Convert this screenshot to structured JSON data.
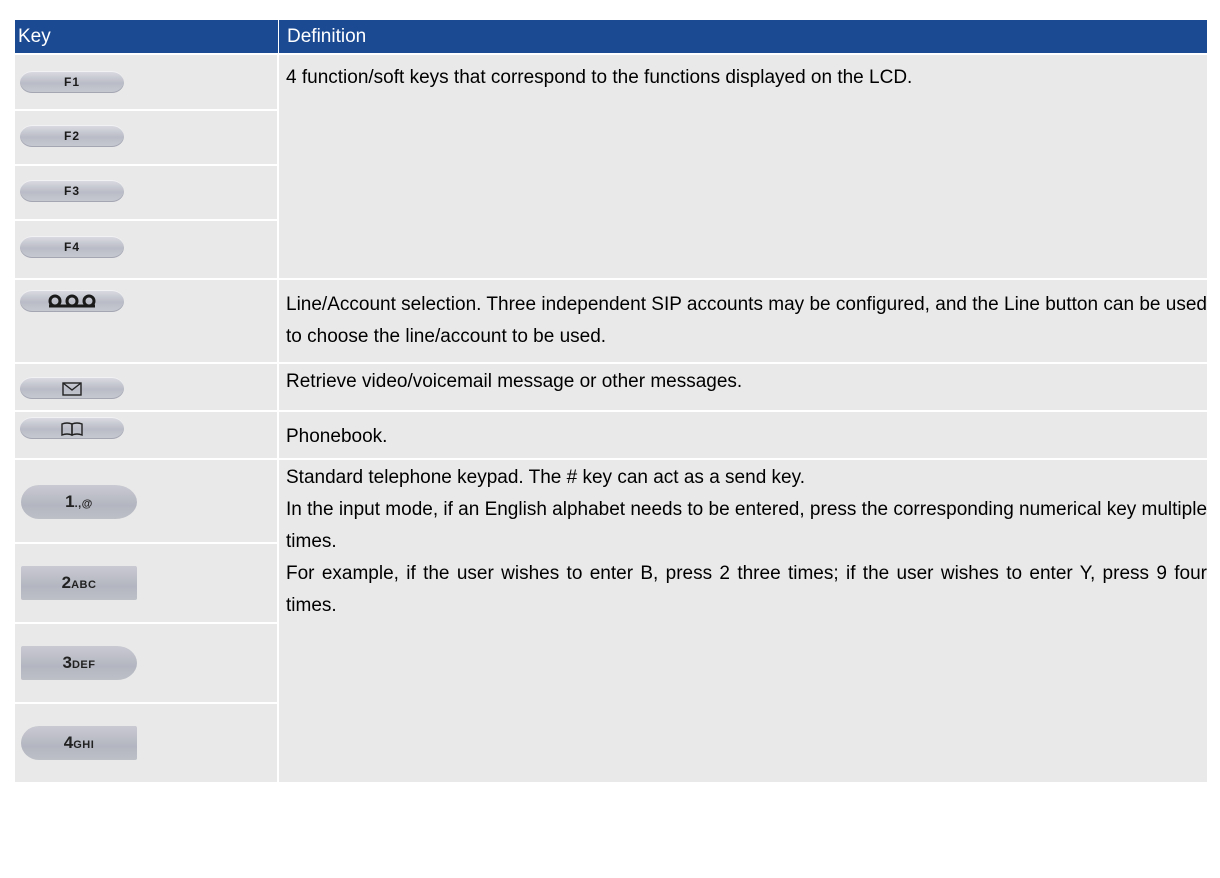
{
  "header": {
    "key": "Key",
    "definition": "Definition"
  },
  "rows": [
    {
      "keys": [
        "F1",
        "F2",
        "F3",
        "F4"
      ],
      "definition": "4 function/soft keys that correspond to the functions displayed on the LCD."
    },
    {
      "key_icon": "line-key-icon",
      "definition": "Line/Account selection. Three independent SIP accounts may be configured, and the Line button can be used to choose the line/account to be used."
    },
    {
      "key_icon": "envelope-icon",
      "definition": "Retrieve video/voicemail message or other messages."
    },
    {
      "key_icon": "book-icon",
      "definition": "Phonebook."
    },
    {
      "keys": [
        {
          "digit": "1",
          "letters": ".,@"
        },
        {
          "digit": "2",
          "letters": "ABC"
        },
        {
          "digit": "3",
          "letters": "DEF"
        },
        {
          "digit": "4",
          "letters": "GHI"
        }
      ],
      "definition_lines": [
        "Standard telephone keypad. The # key can act as a send key.",
        "In the input mode, if an English alphabet needs to be entered, press the corresponding numerical key multiple times.",
        "For example, if the user wishes to enter B, press 2 three times; if the user wishes to enter Y, press 9 four times."
      ]
    }
  ]
}
